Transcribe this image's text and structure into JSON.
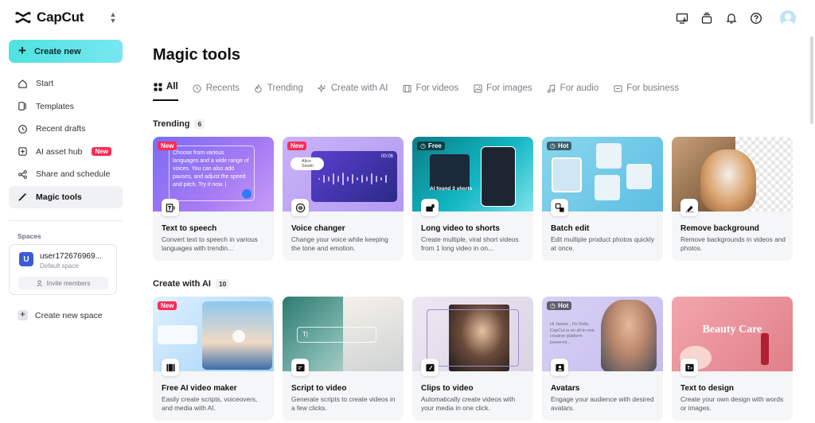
{
  "app": {
    "name": "CapCut"
  },
  "sidebar": {
    "create_label": "Create new",
    "items": [
      {
        "label": "Start",
        "icon": "home-icon"
      },
      {
        "label": "Templates",
        "icon": "templates-icon"
      },
      {
        "label": "Recent drafts",
        "icon": "clock-icon"
      },
      {
        "label": "AI asset hub",
        "icon": "ai-asset-icon",
        "badge": "New"
      },
      {
        "label": "Share and schedule",
        "icon": "share-icon"
      },
      {
        "label": "Magic tools",
        "icon": "magic-wand-icon",
        "active": true
      }
    ],
    "spaces_title": "Spaces",
    "space": {
      "avatar": "U",
      "name": "user172676969...",
      "sub": "Default space",
      "invite": "Invite members"
    },
    "create_space": "Create new space"
  },
  "main": {
    "title": "Magic tools",
    "tabs": [
      {
        "label": "All",
        "active": true
      },
      {
        "label": "Recents"
      },
      {
        "label": "Trending"
      },
      {
        "label": "Create with AI"
      },
      {
        "label": "For videos"
      },
      {
        "label": "For images"
      },
      {
        "label": "For audio"
      },
      {
        "label": "For business"
      }
    ],
    "trending": {
      "title": "Trending",
      "count": "6",
      "cards": [
        {
          "title": "Text to speech",
          "desc": "Convert text to speech in various languages with trendin...",
          "badge": "New",
          "preview_text": "Choose from various languages and a wide range of voices. You can also add pauses, and adjust the speed and pitch. Try it now. |"
        },
        {
          "title": "Voice changer",
          "desc": "Change your voice while keeping the tone and emotion.",
          "badge": "New",
          "preview_time": "00:06",
          "preview_name": "Alice Sewin"
        },
        {
          "title": "Long video to shorts",
          "desc": "Create multiple, viral short videos from 1 long video in on...",
          "badge": "Free",
          "preview_text": "AI found 3 shorts"
        },
        {
          "title": "Batch edit",
          "desc": "Edit multiple product photos quickly at once.",
          "badge": "Hot"
        },
        {
          "title": "Remove background",
          "desc": "Remove backgrounds in videos and photos."
        }
      ]
    },
    "create_ai": {
      "title": "Create with AI",
      "count": "10",
      "cards": [
        {
          "title": "Free AI video maker",
          "desc": "Easily create scripts, voiceovers, and media with AI.",
          "badge": "New"
        },
        {
          "title": "Script to video",
          "desc": "Generate scripts to create videos in a few clicks."
        },
        {
          "title": "Clips to video",
          "desc": "Automatically create videos with your media in one click."
        },
        {
          "title": "Avatars",
          "desc": "Engage your audience with desired avatars.",
          "badge": "Hot",
          "preview_text": "Hi James , I'm Rafa. CapCut is an all-in-one creative platform powered..."
        },
        {
          "title": "Text to design",
          "desc": "Create your own design with words or images.",
          "preview_text": "Beauty Care"
        }
      ]
    }
  },
  "colors": {
    "accent": "#4fe3e0",
    "new_badge": "#fe2c55"
  }
}
